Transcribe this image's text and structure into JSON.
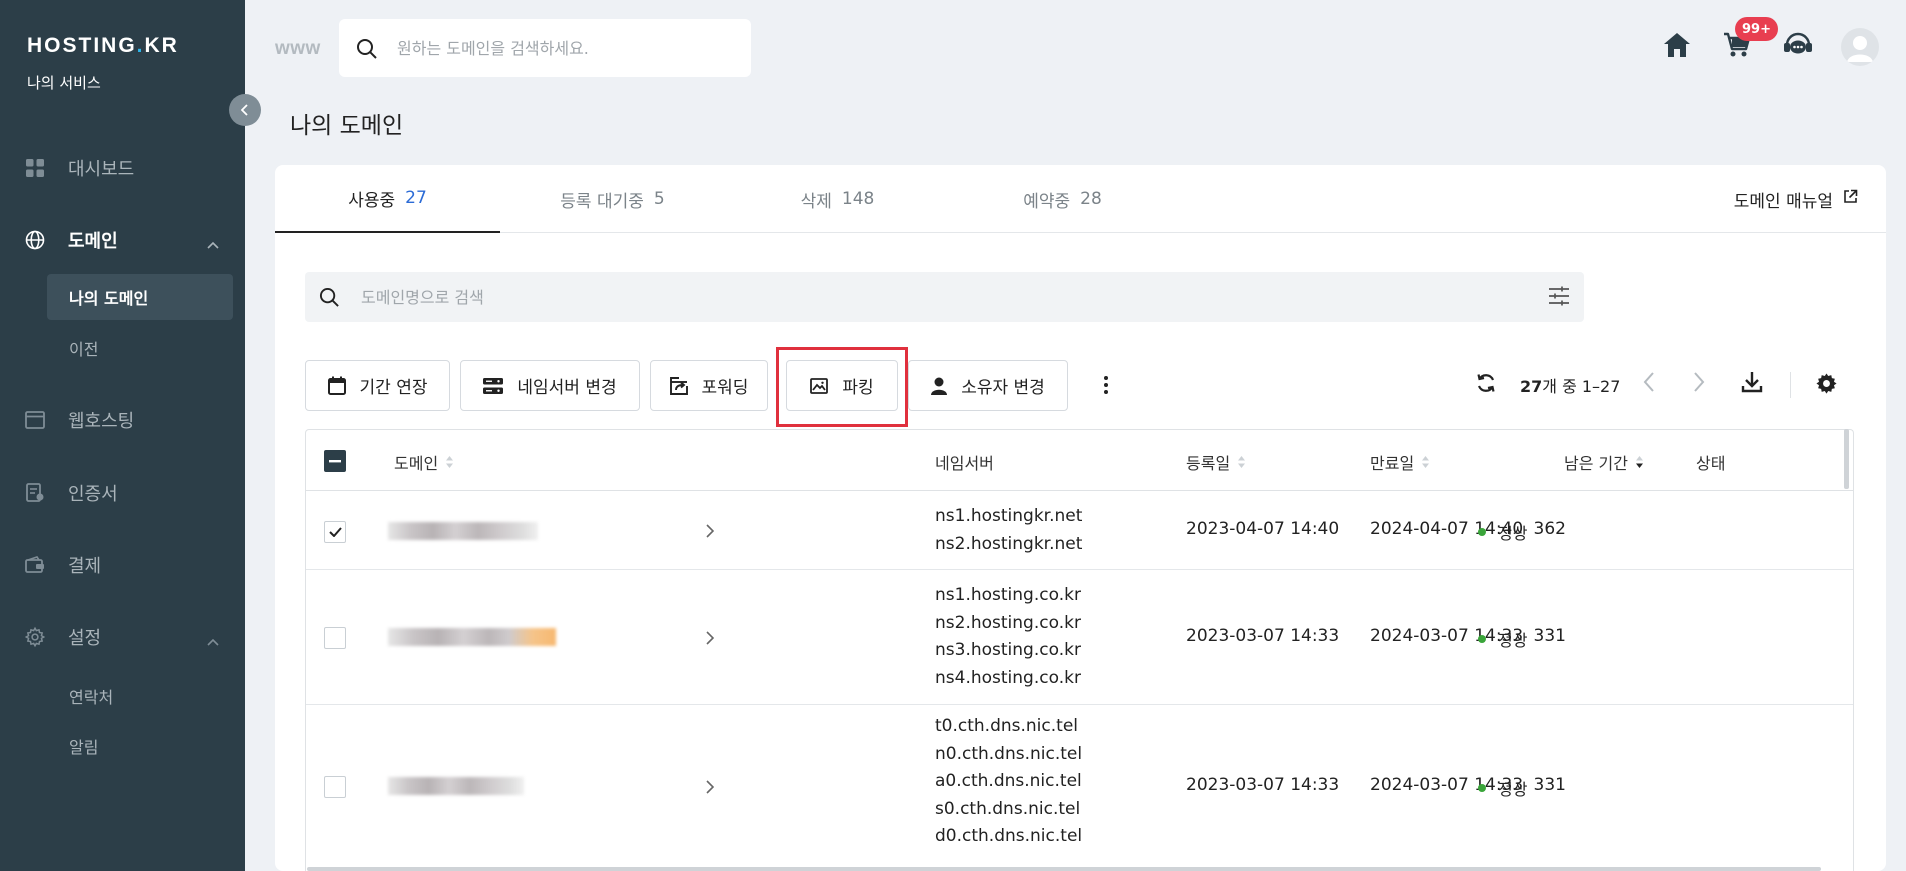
{
  "sidebar": {
    "logo": "HOSTING",
    "logo_dot": ".",
    "logo_suffix": "KR",
    "subtitle": "나의 서비스",
    "nav": {
      "dashboard": "대시보드",
      "domain": "도메인",
      "webhosting": "웹호스팅",
      "certificate": "인증서",
      "payment": "결제",
      "settings": "설정"
    },
    "domain_sub": {
      "my_domain": "나의 도메인",
      "transfer": "이전"
    },
    "settings_sub": {
      "contacts": "연락처",
      "notifications": "알림"
    }
  },
  "topbar": {
    "www": "www",
    "search_placeholder": "원하는 도메인을 검색하세요.",
    "cart_badge": "99+"
  },
  "page": {
    "title": "나의 도메인"
  },
  "tabs": [
    {
      "label": "사용중",
      "count": "27"
    },
    {
      "label": "등록 대기중",
      "count": "5"
    },
    {
      "label": "삭제",
      "count": "148"
    },
    {
      "label": "예약중",
      "count": "28"
    }
  ],
  "manual_link": "도메인 매뉴얼",
  "domain_search": {
    "placeholder": "도메인명으로 검색"
  },
  "toolbar": {
    "extend": "기간 연장",
    "nameserver": "네임서버 변경",
    "forwarding": "포워딩",
    "parking": "파킹",
    "owner": "소유자 변경",
    "count_total": "27",
    "count_text": "개 중 1–27"
  },
  "table": {
    "headers": {
      "domain": "도메인",
      "nameserver": "네임서버",
      "registered": "등록일",
      "expires": "만료일",
      "remaining": "남은 기간",
      "status": "상태"
    },
    "rows": [
      {
        "nameservers": [
          "ns1.hostingkr.net",
          "ns2.hostingkr.net"
        ],
        "registered": "2023-04-07 14:40",
        "expires": "2024-04-07 14:40",
        "remaining": "362",
        "status": "정상"
      },
      {
        "nameservers": [
          "ns1.hosting.co.kr",
          "ns2.hosting.co.kr",
          "ns3.hosting.co.kr",
          "ns4.hosting.co.kr"
        ],
        "registered": "2023-03-07 14:33",
        "expires": "2024-03-07 14:33",
        "remaining": "331",
        "status": "정상"
      },
      {
        "nameservers": [
          "t0.cth.dns.nic.tel",
          "n0.cth.dns.nic.tel",
          "a0.cth.dns.nic.tel",
          "s0.cth.dns.nic.tel",
          "d0.cth.dns.nic.tel"
        ],
        "registered": "2023-03-07 14:33",
        "expires": "2024-03-07 14:33",
        "remaining": "331",
        "status": "정상"
      }
    ]
  },
  "colors": {
    "sidebar_bg": "#2c3e48",
    "accent_blue": "#2b6bd6",
    "highlight_red": "#e0303d",
    "status_green": "#3aa53a",
    "badge_red": "#e83e50"
  }
}
